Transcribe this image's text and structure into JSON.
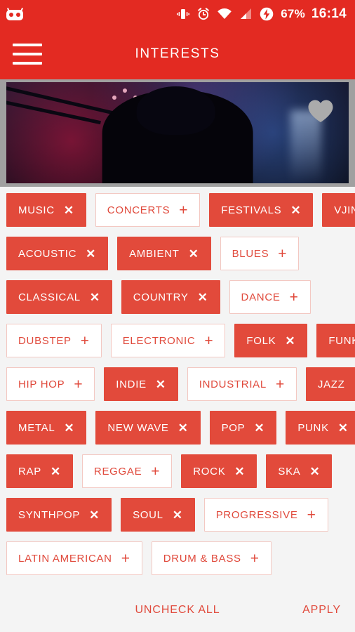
{
  "statusbar": {
    "os_logo": "cyanogenmod-logo",
    "icons": [
      "vibrate-icon",
      "alarm-icon",
      "wifi-icon",
      "signal-icon",
      "battery-charging-icon"
    ],
    "battery_percent": "67%",
    "time": "16:14"
  },
  "appbar": {
    "menu_icon": "hamburger-menu-icon",
    "title": "INTERESTS"
  },
  "hero": {
    "alt": "concert-photo",
    "favorite_icon": "heart-icon",
    "favorite_color": "#ababab"
  },
  "colors": {
    "header_red": "#e32a22",
    "chip_red": "#e24a3b",
    "chip_text_red": "#e0493b",
    "chip_border": "#f3c8c2",
    "page_background": "#f4f4f4",
    "hero_frame_gray": "#a0a0a0"
  },
  "marks": {
    "selected": "✕",
    "unselected": "+"
  },
  "chip_rows": [
    [
      {
        "label": "MUSIC",
        "selected": true
      },
      {
        "label": "CONCERTS",
        "selected": false
      },
      {
        "label": "FESTIVALS",
        "selected": true
      },
      {
        "label": "VJING",
        "selected": true
      }
    ],
    [
      {
        "label": "ACOUSTIC",
        "selected": true
      },
      {
        "label": "AMBIENT",
        "selected": true
      },
      {
        "label": "BLUES",
        "selected": false
      }
    ],
    [
      {
        "label": "CLASSICAL",
        "selected": true
      },
      {
        "label": "COUNTRY",
        "selected": true
      },
      {
        "label": "DANCE",
        "selected": false
      }
    ],
    [
      {
        "label": "DUBSTEP",
        "selected": false
      },
      {
        "label": "ELECTRONIC",
        "selected": false
      },
      {
        "label": "FOLK",
        "selected": true
      },
      {
        "label": "FUNK",
        "selected": true
      }
    ],
    [
      {
        "label": "HIP HOP",
        "selected": false
      },
      {
        "label": "INDIE",
        "selected": true
      },
      {
        "label": "INDUSTRIAL",
        "selected": false
      },
      {
        "label": "JAZZ",
        "selected": true
      }
    ],
    [
      {
        "label": "METAL",
        "selected": true
      },
      {
        "label": "NEW WAVE",
        "selected": true
      },
      {
        "label": "POP",
        "selected": true
      },
      {
        "label": "PUNK",
        "selected": true
      }
    ],
    [
      {
        "label": "RAP",
        "selected": true
      },
      {
        "label": "REGGAE",
        "selected": false
      },
      {
        "label": "ROCK",
        "selected": true
      },
      {
        "label": "SKA",
        "selected": true
      }
    ],
    [
      {
        "label": "SYNTHPOP",
        "selected": true
      },
      {
        "label": "SOUL",
        "selected": true
      },
      {
        "label": "PROGRESSIVE",
        "selected": false
      }
    ],
    [
      {
        "label": "LATIN AMERICAN",
        "selected": false
      },
      {
        "label": "DRUM & BASS",
        "selected": false
      }
    ]
  ],
  "footer": {
    "uncheck_all_label": "UNCHECK ALL",
    "apply_label": "APPLY"
  }
}
